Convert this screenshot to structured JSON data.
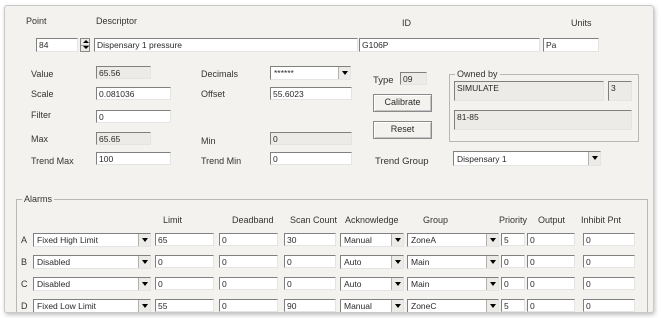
{
  "header": {
    "point_label": "Point",
    "descriptor_label": "Descriptor",
    "id_label": "ID",
    "units_label": "Units",
    "point_value": "84",
    "descriptor_value": "Dispensary 1 pressure",
    "id_value": "G106P",
    "units_value": "Pa"
  },
  "fields": {
    "value_label": "Value",
    "value": "65.56",
    "scale_label": "Scale",
    "scale": "0.081036",
    "filter_label": "Filter",
    "filter": "0",
    "max_label": "Max",
    "max": "65.65",
    "trend_max_label": "Trend Max",
    "trend_max": "100",
    "decimals_label": "Decimals",
    "decimals": "******",
    "offset_label": "Offset",
    "offset": "55.6023",
    "min_label": "Min",
    "min": "0",
    "trend_min_label": "Trend Min",
    "trend_min": "0",
    "type_label": "Type",
    "type_value": "09",
    "calibrate_label": "Calibrate",
    "reset_label": "Reset",
    "trend_group_label": "Trend Group",
    "trend_group": "Dispensary 1"
  },
  "owned_by": {
    "title": "Owned by",
    "name": "SIMULATE",
    "number": "3",
    "range": "81-85"
  },
  "alarms": {
    "title": "Alarms",
    "headers": {
      "limit": "Limit",
      "deadband": "Deadband",
      "scan_count": "Scan Count",
      "acknowledge": "Acknowledge",
      "group": "Group",
      "priority": "Priority",
      "output": "Output",
      "inhibit": "Inhibit Pnt"
    },
    "rows": [
      {
        "letter": "A",
        "type": "Fixed High Limit",
        "limit": "65",
        "deadband": "0",
        "scan_count": "30",
        "acknowledge": "Manual",
        "group": "ZoneA",
        "priority": "5",
        "output": "0",
        "inhibit": "0"
      },
      {
        "letter": "B",
        "type": "Disabled",
        "limit": "0",
        "deadband": "0",
        "scan_count": "0",
        "acknowledge": "Auto",
        "group": "Main",
        "priority": "0",
        "output": "0",
        "inhibit": "0"
      },
      {
        "letter": "C",
        "type": "Disabled",
        "limit": "0",
        "deadband": "0",
        "scan_count": "0",
        "acknowledge": "Auto",
        "group": "Main",
        "priority": "0",
        "output": "0",
        "inhibit": "0"
      },
      {
        "letter": "D",
        "type": "Fixed Low Limit",
        "limit": "55",
        "deadband": "0",
        "scan_count": "90",
        "acknowledge": "Manual",
        "group": "ZoneC",
        "priority": "5",
        "output": "0",
        "inhibit": "0"
      }
    ]
  }
}
